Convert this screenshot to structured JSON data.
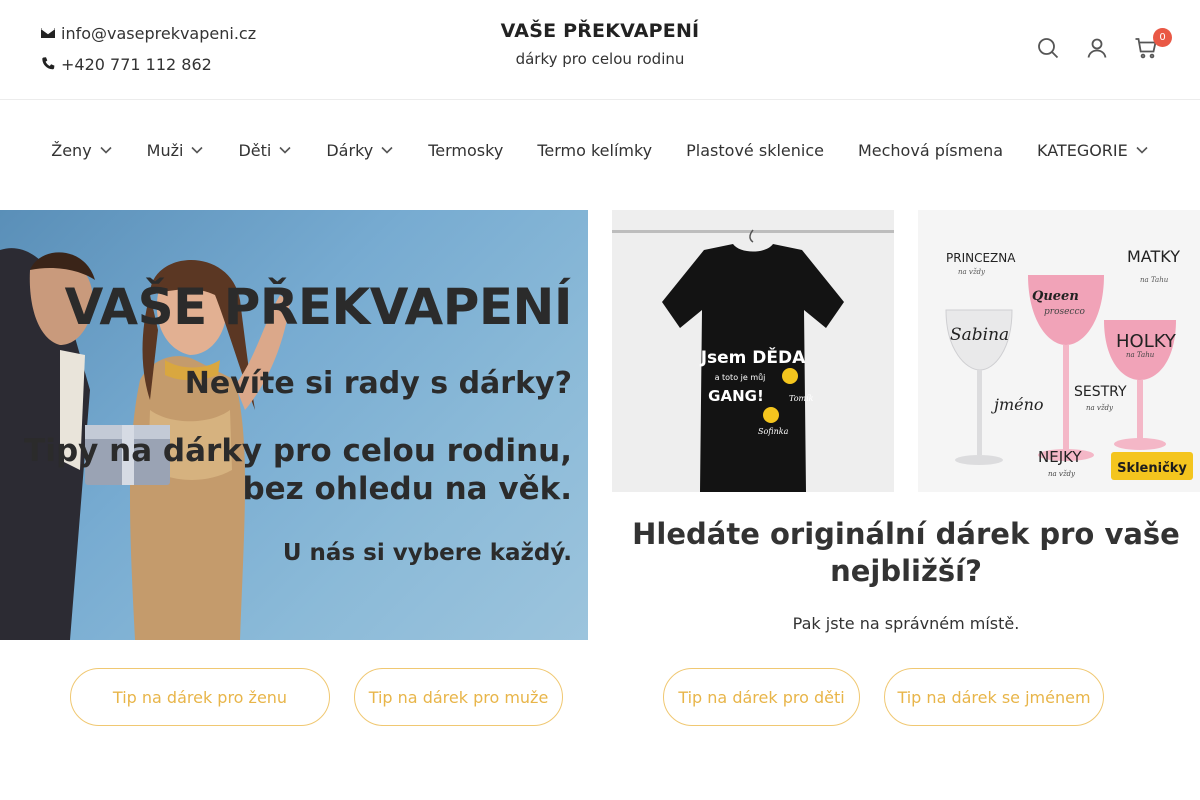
{
  "contact": {
    "email": "info@vaseprekvapeni.cz",
    "phone": "+420 771 112 862",
    "email_icon": "envelope-icon",
    "phone_icon": "phone-icon"
  },
  "brand": {
    "title": "VAŠE PŘEKVAPENÍ",
    "subtitle": "dárky pro celou rodinu"
  },
  "header_icons": {
    "search": "search-icon",
    "account": "user-icon",
    "cart": "cart-icon",
    "cart_count": "0"
  },
  "nav": {
    "items": [
      {
        "label": "Ženy",
        "dropdown": true
      },
      {
        "label": "Muži",
        "dropdown": true
      },
      {
        "label": "Děti",
        "dropdown": true
      },
      {
        "label": "Dárky",
        "dropdown": true
      },
      {
        "label": "Termosky",
        "dropdown": false
      },
      {
        "label": "Termo kelímky",
        "dropdown": false
      },
      {
        "label": "Plastové sklenice",
        "dropdown": false
      },
      {
        "label": "Mechová písmena",
        "dropdown": false
      },
      {
        "label": "KATEGORIE",
        "dropdown": true
      }
    ]
  },
  "hero": {
    "title": "VAŠE PŘEKVAPENÍ",
    "question": "Nevíte si rady s dárky?",
    "tip": "Tipy na dárky pro celou rodinu, bez ohledu na věk.",
    "every": "U nás si vybere každý."
  },
  "products": {
    "tshirt": {
      "line1": "Jsem DĚDA",
      "line2": "a toto je můj",
      "line3": "GANG!",
      "name1": "Tomík",
      "name2": "Sofinka"
    },
    "glasses": {
      "w1": "PRINCEZNA",
      "w1s": "na vždy",
      "w2": "MATKY",
      "w2s": "na Tahu",
      "w3": "Queen",
      "w3s": "prosecco",
      "w4": "Sabina",
      "w5": "HOLKY",
      "w5s": "na Tahu",
      "w6": "jméno",
      "w7": "SESTRY",
      "w7s": "na vždy",
      "w8": "NEJKY",
      "w8s": "na vždy",
      "badge": "Skleničky"
    }
  },
  "promo": {
    "headline": "Hledáte originální dárek pro vaše nejbližší?",
    "tagline": "Pak jste na správném místě."
  },
  "buttons": {
    "women": "Tip na dárek pro ženu",
    "men": "Tip na dárek pro muže",
    "kids": "Tip na dárek pro děti",
    "name": "Tip na dárek se jménem"
  },
  "colors": {
    "accent": "#e8b549",
    "button_border": "#f0c872",
    "badge": "#e95845",
    "hero_bg": "#77abd1"
  }
}
